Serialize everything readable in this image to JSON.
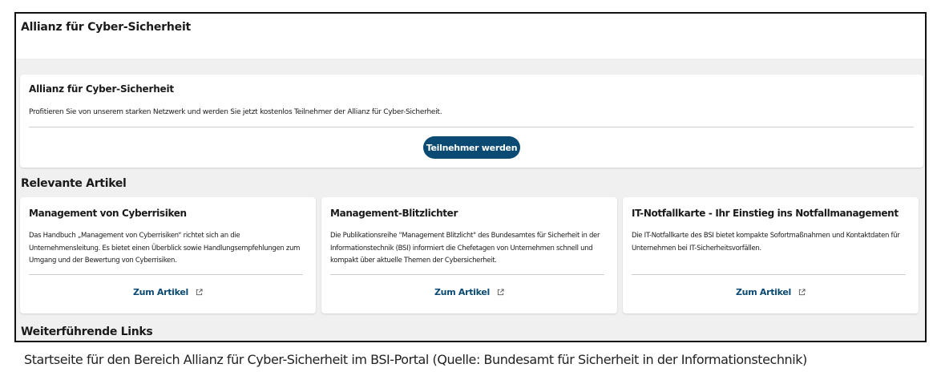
{
  "header": {
    "title": "Allianz für Cyber-Sicherheit"
  },
  "hero": {
    "title": "Allianz für Cyber-Sicherheit",
    "text": "Profitieren Sie von unserem starken Netzwerk und werden Sie jetzt kostenlos Teilnehmer der Allianz für Cyber-Sicherheit.",
    "button_label": "Teilnehmer werden"
  },
  "articles": {
    "section_title": "Relevante Artikel",
    "items": [
      {
        "title": "Management von Cyberrisiken",
        "text": "Das Handbuch „Management von Cyberrisiken“ richtet sich an die Unternehmensleitung. Es bietet einen Überblick sowie Handlungsempfehlungen zum Umgang und der Bewertung von Cyberrisiken.",
        "link_label": "Zum Artikel"
      },
      {
        "title": "Management-Blitzlichter",
        "text": "Die Publikationsreihe \"Management Blitzlicht\" des Bundesamtes für Sicherheit in der Informationstechnik (BSI) informiert die Chefetagen von Unternehmen schnell und kompakt über aktuelle Themen der Cybersicherheit.",
        "link_label": "Zum Artikel"
      },
      {
        "title": "IT-Notfallkarte - Ihr Einstieg ins Notfallmanagement",
        "text": "Die IT-Notfallkarte des BSI bietet kompakte Sofortmaßnahmen und Kontaktdaten für Unternehmen bei IT-Sicherheitsvorfällen.",
        "link_label": "Zum Artikel"
      }
    ]
  },
  "links": {
    "section_title": "Weiterführende Links"
  },
  "caption": "Startseite für den Bereich Allianz für Cyber-Sicherheit im BSI-Portal (Quelle: Bundesamt für Sicherheit in der Informationstechnik)",
  "icons": {
    "article_link_icon": "external-link-icon"
  },
  "colors": {
    "accent": "#0b4a72",
    "page_background": "#f0f0f0"
  }
}
